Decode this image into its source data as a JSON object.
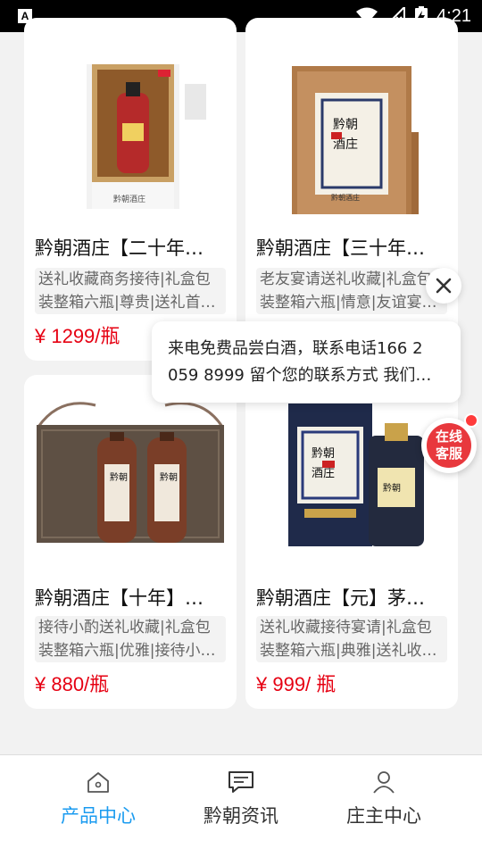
{
  "status_bar": {
    "time": "4:21",
    "app_icon": "A"
  },
  "products": [
    {
      "title": "黔朝酒庄【二十年…",
      "desc_line1": "送礼收藏商务接待|礼盒包",
      "desc_line2": "装整箱六瓶|尊贵|送礼首…",
      "price": "¥ 1299/瓶",
      "image": "gold-gift-box-bottle"
    },
    {
      "title": "黔朝酒庄【三十年…",
      "desc_line1": "老友宴请送礼收藏|礼盒包",
      "desc_line2": "装整箱六瓶|情意|友谊宴…",
      "price": "",
      "image": "kraft-gift-box"
    },
    {
      "title": "黔朝酒庄【十年】…",
      "desc_line1": "接待小酌送礼收藏|礼盒包",
      "desc_line2": "装整箱六瓶|优雅|接待小…",
      "price": "¥ 880/瓶",
      "image": "wooden-crate-two-bottles"
    },
    {
      "title": "黔朝酒庄【元】茅…",
      "desc_line1": "送礼收藏接待宴请|礼盒包",
      "desc_line2": "装整箱六瓶|典雅|送礼收…",
      "price": "¥ 999/ 瓶",
      "image": "blue-box-bottle"
    }
  ],
  "popup": {
    "line1": "来电免费品尝白酒，联系电话166 2",
    "line2": "059 8999 留个您的联系方式 我们…"
  },
  "customer_service": {
    "line1": "在线",
    "line2": "客服"
  },
  "tabs": [
    {
      "label": "产品中心",
      "icon": "home-icon",
      "active": true
    },
    {
      "label": "黔朝资讯",
      "icon": "message-icon",
      "active": false
    },
    {
      "label": "庄主中心",
      "icon": "user-icon",
      "active": false
    }
  ],
  "colors": {
    "price": "#e60012",
    "active_tab": "#1a9bf0",
    "inactive_tab": "#333333",
    "badge": "#e8383d"
  }
}
